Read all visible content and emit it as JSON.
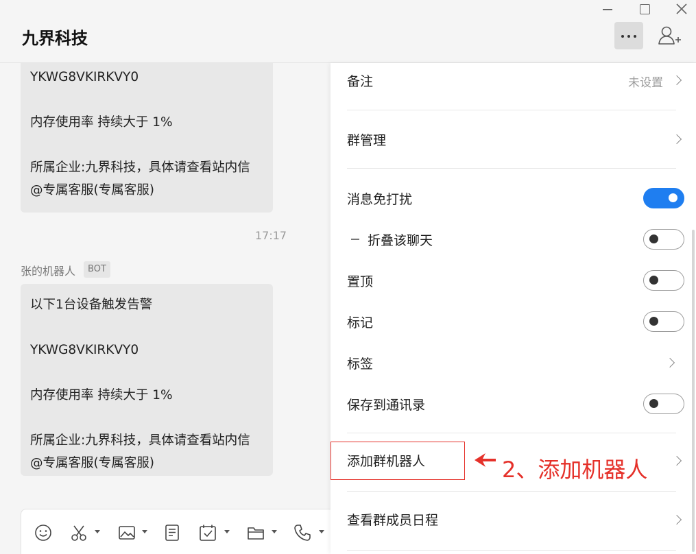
{
  "window": {
    "title": "九界科技"
  },
  "chat": {
    "message1": {
      "lines": [
        "YKWG8VKIRKVY0",
        "",
        "内存使用率 持续大于 1%",
        "",
        "所属企业:九界科技，具体请查看站内信",
        "@专属客服(专属客服)"
      ]
    },
    "timestamp": "17:17",
    "sender": "张的机器人",
    "bot_badge": "BOT",
    "message2": {
      "lines": [
        "以下1台设备触发告警",
        "",
        "YKWG8VKIRKVY0",
        "",
        "内存使用率 持续大于 1%",
        "",
        "所属企业:九界科技，具体请查看站内信",
        "@专属客服(专属客服)"
      ]
    },
    "toolbar_icons": [
      "emoji-icon",
      "scissors-icon",
      "image-icon",
      "document-icon",
      "calendar-check-icon",
      "folder-icon",
      "phone-icon"
    ]
  },
  "settings": {
    "remark": {
      "label": "备注",
      "value": "未设置"
    },
    "group_manage": {
      "label": "群管理"
    },
    "mute": {
      "label": "消息免打扰",
      "on": true
    },
    "fold_chat": {
      "label": "折叠该聊天",
      "on": false
    },
    "pin": {
      "label": "置顶",
      "on": false
    },
    "mark": {
      "label": "标记",
      "on": false
    },
    "tags": {
      "label": "标签"
    },
    "save_contacts": {
      "label": "保存到通讯录",
      "on": false
    },
    "add_bot": {
      "label": "添加群机器人"
    },
    "member_schedule": {
      "label": "查看群成员日程"
    }
  },
  "annotation": {
    "text": "2、添加机器人",
    "color": "#e5312a"
  },
  "colors": {
    "accent": "#1f7ef0",
    "annotation": "#e5312a"
  }
}
